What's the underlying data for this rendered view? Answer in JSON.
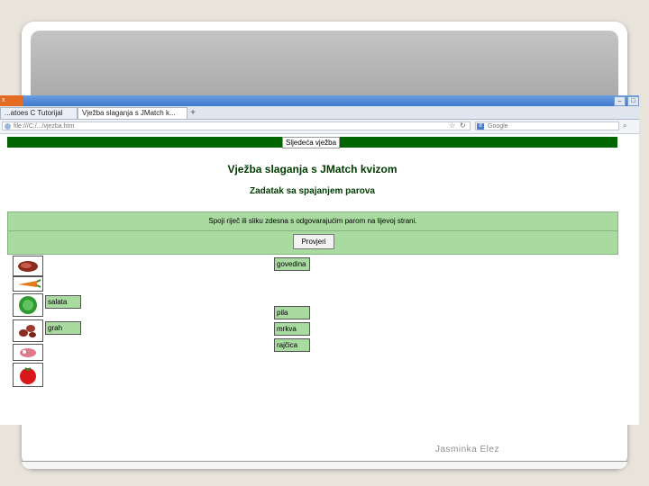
{
  "browser": {
    "title_tab": "x",
    "tabs": [
      "...atoes C Tutorijal",
      "Vježba slaganja s JMatch k..."
    ],
    "new_tab": "+",
    "url": "file:///C:/.../vjezba.htm",
    "search_placeholder": "Google",
    "win_buttons": [
      "–",
      "□"
    ]
  },
  "page": {
    "next_button": "Sljedeća vježba",
    "title": "Vježba slaganja s JMatch kvizom",
    "subtitle": "Zadatak sa spajanjem parova",
    "instructions": "Spoji riječ ili sliku zdesna s odgovarajućim parom na lijevoj strani.",
    "check_button": "Provjeri",
    "matched": [
      "salata",
      "grah"
    ],
    "words": [
      "govedina",
      "pila",
      "mrkva",
      "rajčica"
    ]
  },
  "footer": {
    "author": "Jasminka Elez"
  },
  "colors": {
    "nav_green": "#006400",
    "cell_green": "#a9dba0"
  }
}
